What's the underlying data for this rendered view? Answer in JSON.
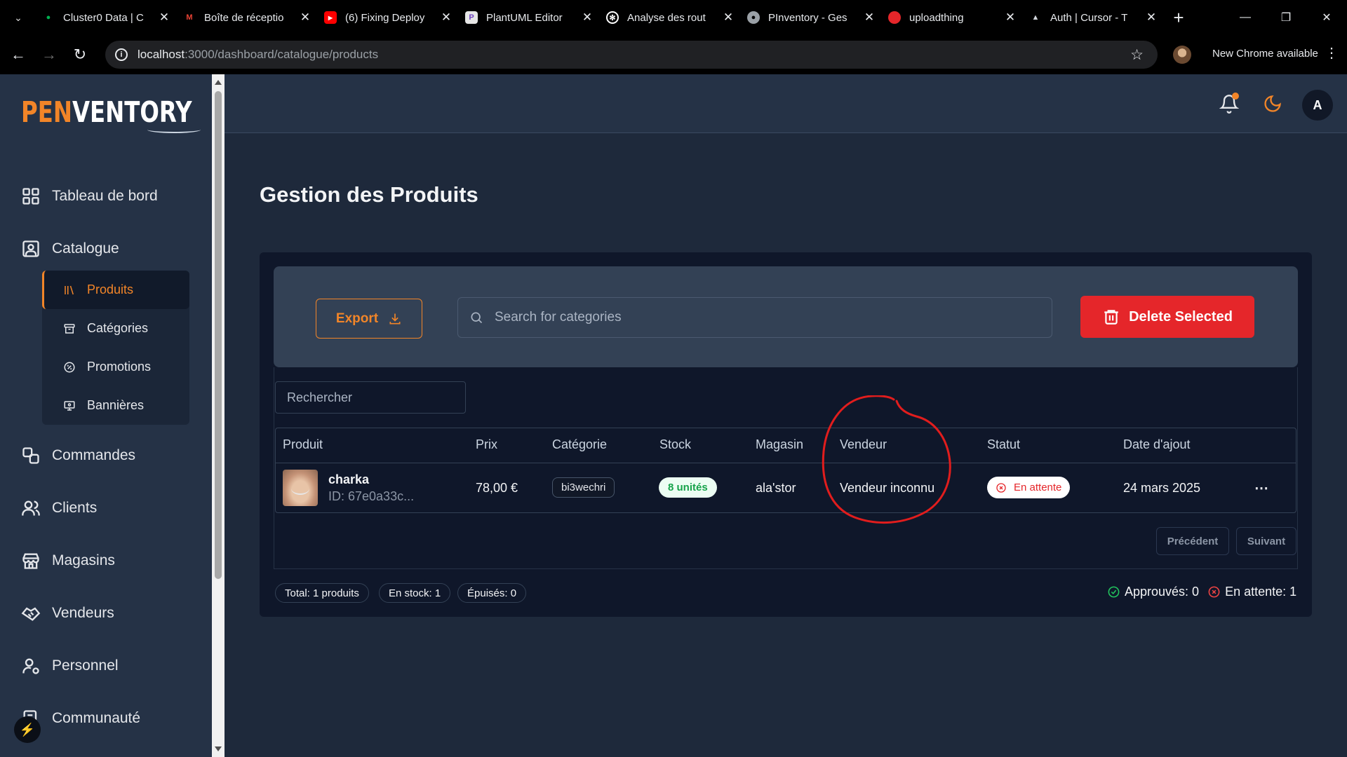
{
  "browser": {
    "tabs": [
      {
        "title": "Cluster0 Data | C",
        "icon": "mongodb-leaf-icon",
        "color": "#00b050"
      },
      {
        "title": "Boîte de réceptio",
        "icon": "gmail-icon",
        "color": "#ea4335"
      },
      {
        "title": "(6) Fixing Deploy",
        "icon": "youtube-icon",
        "color": "#ff0000"
      },
      {
        "title": "PlantUML Editor",
        "icon": "plantuml-icon",
        "color": "#6f42c1"
      },
      {
        "title": "Analyse des rout",
        "icon": "openai-icon",
        "color": "#ffffff"
      },
      {
        "title": "PInventory - Ges",
        "icon": "globe-icon",
        "color": "#9aa0a6"
      },
      {
        "title": "uploadthing",
        "icon": "uploadthing-icon",
        "color": "#e5262a"
      },
      {
        "title": "Auth | Cursor - T",
        "icon": "cursor-icon",
        "color": "#d1d5db"
      }
    ],
    "url_host": "localhost",
    "url_path": ":3000/dashboard/catalogue/products",
    "new_chrome": "New Chrome available"
  },
  "sidebar": {
    "logo_pen": "PEN",
    "logo_ventory": "VENTORY",
    "items": [
      {
        "label": "Tableau de bord",
        "icon": "grid-icon"
      },
      {
        "label": "Catalogue",
        "icon": "image-icon"
      },
      {
        "label": "Commandes",
        "icon": "orders-icon"
      },
      {
        "label": "Clients",
        "icon": "users-icon"
      },
      {
        "label": "Magasins",
        "icon": "store-icon"
      },
      {
        "label": "Vendeurs",
        "icon": "handshake-icon"
      },
      {
        "label": "Personnel",
        "icon": "user-cog-icon"
      },
      {
        "label": "Communauté",
        "icon": "community-icon"
      }
    ],
    "sub_items": [
      {
        "label": "Produits",
        "icon": "library-icon",
        "active": true
      },
      {
        "label": "Catégories",
        "icon": "archive-icon"
      },
      {
        "label": "Promotions",
        "icon": "percent-badge-icon"
      },
      {
        "label": "Bannières",
        "icon": "presentation-icon"
      }
    ]
  },
  "header": {
    "avatar_initial": "A",
    "accent": "#f28528"
  },
  "page": {
    "title": "Gestion des Produits"
  },
  "toolbar": {
    "export_label": "Export",
    "search_placeholder": "Search for categories",
    "delete_label": "Delete Selected",
    "delete_color": "#e5262a"
  },
  "table": {
    "filter_placeholder": "Rechercher",
    "columns": [
      "Produit",
      "Prix",
      "Catégorie",
      "Stock",
      "Magasin",
      "Vendeur",
      "Statut",
      "Date d'ajout"
    ],
    "rows": [
      {
        "name": "charka",
        "id": "ID: 67e0a33c...",
        "price": "78,00 €",
        "category": "bi3wechri",
        "stock": "8 unités",
        "store": "ala'stor",
        "seller": "Vendeur inconnu",
        "status": "En attente",
        "date": "24 mars 2025"
      }
    ],
    "prev_label": "Précédent",
    "next_label": "Suivant"
  },
  "summary": {
    "total": "Total: 1 produits",
    "in_stock": "En stock: 1",
    "out_of_stock": "Épuisés: 0",
    "approved": "Approuvés: 0",
    "pending": "En attente: 1"
  }
}
